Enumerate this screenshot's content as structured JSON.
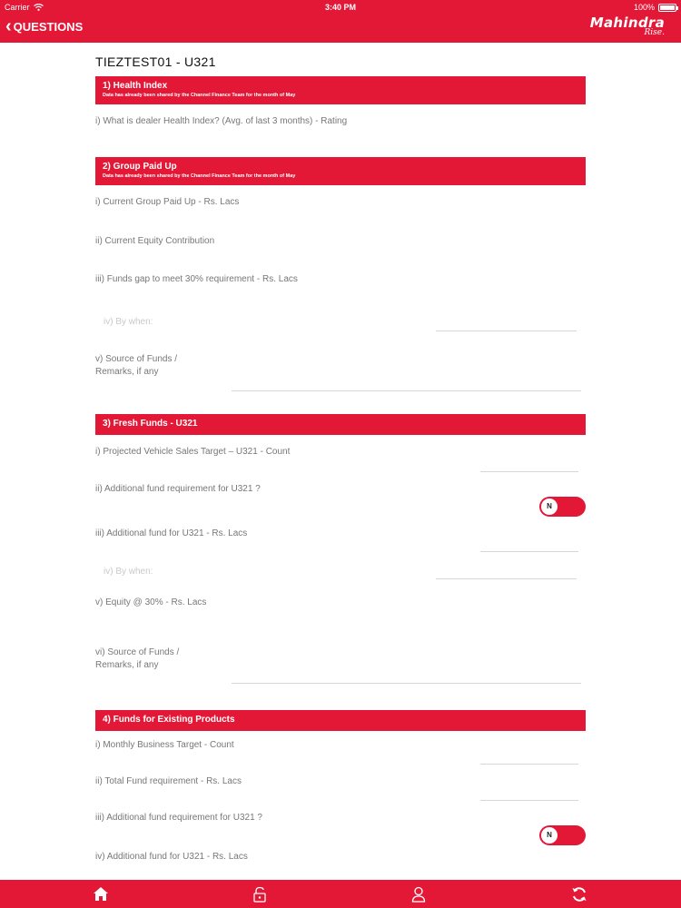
{
  "status_bar": {
    "carrier": "Carrier",
    "time": "3:40 PM",
    "battery": "100%"
  },
  "header": {
    "back_label": "QUESTIONS",
    "brand_name": "Mahindra",
    "brand_tagline": "Rise."
  },
  "page": {
    "title": "TIEZTEST01 - U321"
  },
  "sections": {
    "s1": {
      "title": "1) Health Index",
      "note": "Data has already been shared by the Channel Finance Team for the month of May",
      "questions": [
        "i) What is dealer Health Index? (Avg. of last 3 months) - Rating"
      ]
    },
    "s2": {
      "title": "2) Group Paid Up",
      "note": "Data has already been shared by the Channel Finance Team for the month of May",
      "questions": [
        "i) Current Group Paid Up - Rs. Lacs",
        "ii) Current Equity Contribution",
        "iii) Funds gap to meet 30% requirement - Rs. Lacs",
        "iv) By when:",
        "v) Source of Funds /",
        "Remarks, if any"
      ]
    },
    "s3": {
      "title": "3) Fresh Funds - U321",
      "questions": [
        "i) Projected Vehicle Sales Target – U321 - Count",
        "ii) Additional fund requirement for U321 ?",
        "iii) Additional fund for U321 - Rs. Lacs",
        "iv) By when:",
        "v) Equity @ 30% - Rs. Lacs",
        "vi) Source of Funds /",
        "Remarks, if any"
      ],
      "toggle_label": "N"
    },
    "s4": {
      "title": "4) Funds for Existing Products",
      "questions": [
        "i) Monthly Business Target - Count",
        "ii) Total Fund requirement - Rs. Lacs",
        "iii) Additional fund requirement for U321 ?",
        "iv) Additional fund for U321 - Rs. Lacs"
      ],
      "toggle_label": "N"
    }
  },
  "tabbar": {
    "icons": [
      "home-icon",
      "unlock-icon",
      "user-icon",
      "sync-icon"
    ]
  },
  "colors": {
    "brand_red": "#e31837",
    "label_gray": "#777777",
    "line_gray": "#d6d6d6"
  }
}
